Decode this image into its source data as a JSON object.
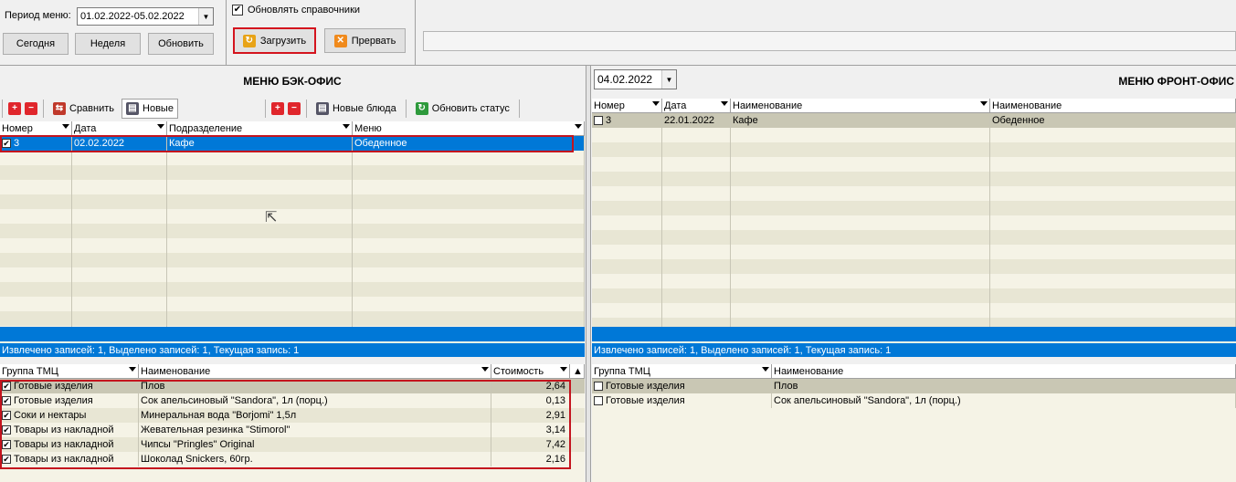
{
  "toolbar": {
    "period_label": "Период меню:",
    "period_value": "01.02.2022-05.02.2022",
    "today": "Сегодня",
    "week": "Неделя",
    "refresh": "Обновить",
    "update_refs_label": "Обновлять справочники",
    "load": "Загрузить",
    "abort": "Прервать"
  },
  "left": {
    "title": "МЕНЮ БЭК-ОФИС",
    "compare": "Сравнить",
    "new": "Новые",
    "new_dishes": "Новые блюда",
    "update_status": "Обновить статус",
    "columns": [
      "Номер",
      "Дата",
      "Подразделение",
      "Меню"
    ],
    "rows": [
      {
        "checked": true,
        "num": "3",
        "date": "02.02.2022",
        "dept": "Кафе",
        "menu": "Обеденное"
      }
    ],
    "status": "Извлечено записей: 1, Выделено записей: 1, Текущая запись: 1",
    "detail_columns": [
      "Группа ТМЦ",
      "Наименование",
      "Стоимость"
    ],
    "detail_rows": [
      {
        "group": "Готовые изделия",
        "name": "Плов",
        "cost": "2,64"
      },
      {
        "group": "Готовые изделия",
        "name": "Сок апельсиновый \"Sandora\", 1л (порц.)",
        "cost": "0,13"
      },
      {
        "group": "Соки и нектары",
        "name": "Минеральная вода \"Borjomi\" 1,5л",
        "cost": "2,91"
      },
      {
        "group": "Товары из накладной",
        "name": "Жевательная резинка \"Stimorol\"",
        "cost": "3,14"
      },
      {
        "group": "Товары из накладной",
        "name": "Чипсы \"Pringles\" Original",
        "cost": "7,42"
      },
      {
        "group": "Товары из накладной",
        "name": "Шоколад Snickers, 60гр.",
        "cost": "2,16"
      }
    ]
  },
  "right": {
    "title": "МЕНЮ ФРОНТ-ОФИС",
    "date_value": "04.02.2022",
    "columns": [
      "Номер",
      "Дата",
      "Наименование",
      "Наименование"
    ],
    "rows": [
      {
        "num": "3",
        "date": "22.01.2022",
        "name": "Кафе",
        "name2": "Обеденное"
      }
    ],
    "status": "Извлечено записей: 1, Выделено записей: 1, Текущая запись: 1",
    "detail_columns": [
      "Группа ТМЦ",
      "Наименование"
    ],
    "detail_rows": [
      {
        "group": "Готовые изделия",
        "name": "Плов"
      },
      {
        "group": "Готовые изделия",
        "name": "Сок апельсиновый \"Sandora\", 1л (порц.)"
      }
    ]
  },
  "colors": {
    "selection": "#0078d7",
    "grid_bg": "#f5f3e6",
    "grid_alt": "#e8e6d4",
    "highlight": "#c4141e"
  },
  "icons": [
    "plus-icon",
    "minus-icon",
    "compare-icon",
    "new-doc-icon",
    "new-dishes-icon",
    "refresh-status-icon",
    "load-icon",
    "abort-icon",
    "dropdown-arrow-icon",
    "mouse-cursor-icon"
  ]
}
